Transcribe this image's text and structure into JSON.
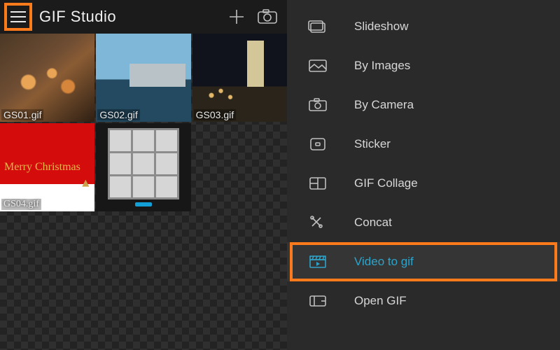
{
  "header": {
    "title": "GIF Studio"
  },
  "thumbnails": [
    {
      "filename": "GS01.gif"
    },
    {
      "filename": "GS02.gif"
    },
    {
      "filename": "GS03.gif"
    },
    {
      "filename": "GS04.gif",
      "overlay_text": "Merry Christmas"
    },
    {
      "filename": ""
    }
  ],
  "menu": [
    {
      "id": "slideshow",
      "label": "Slideshow",
      "icon": "slideshow-icon"
    },
    {
      "id": "byimages",
      "label": "By Images",
      "icon": "images-icon"
    },
    {
      "id": "bycamera",
      "label": "By Camera",
      "icon": "camera-icon"
    },
    {
      "id": "sticker",
      "label": "Sticker",
      "icon": "sticker-icon"
    },
    {
      "id": "gifcollage",
      "label": "GIF Collage",
      "icon": "collage-icon"
    },
    {
      "id": "concat",
      "label": "Concat",
      "icon": "concat-icon"
    },
    {
      "id": "videotogif",
      "label": "Video to gif",
      "icon": "clapper-icon",
      "active": true,
      "highlighted": true
    },
    {
      "id": "opengif",
      "label": "Open GIF",
      "icon": "open-icon"
    }
  ],
  "annotations": {
    "hamburger_highlight_color": "#ff7a1a",
    "menu_highlight_color": "#ff7a1a"
  }
}
